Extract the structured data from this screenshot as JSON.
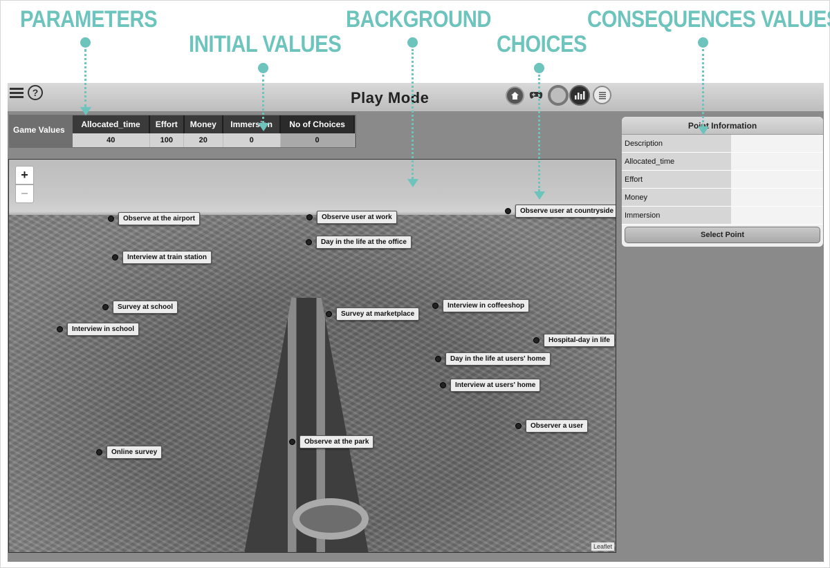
{
  "callouts": {
    "parameters": "PARAMETERS",
    "initial_values": "INITIAL VALUES",
    "background": "BACKGROUND",
    "choices": "CHOICES",
    "consequences_values": "CONSEQUENCES VALUES"
  },
  "colors": {
    "callout_accent": "#6cc4bd",
    "header_bg": "#c8c8c8",
    "app_bg": "#8a8a8a",
    "table_header_bg": "#3a3a3a"
  },
  "header": {
    "title": "Play Mode",
    "left_icons": [
      "language-icon",
      "help-icon"
    ],
    "right_icons": [
      "home-icon",
      "gamepad-icon",
      "cycle-icon",
      "stats-icon",
      "list-icon"
    ]
  },
  "game_values": {
    "label": "Game Values",
    "columns": [
      "Allocated_time",
      "Effort",
      "Money",
      "Immersion",
      "No of Choices"
    ],
    "values": [
      "40",
      "100",
      "20",
      "0",
      "0"
    ]
  },
  "map": {
    "zoom_in": "+",
    "zoom_out": "−",
    "attribution": "Leaflet",
    "markers": [
      "Observe at the airport",
      "Observe user at work",
      "Observe user at countryside",
      "Day in the life at the office",
      "Interview at train station",
      "Survey at school",
      "Interview in coffeeshop",
      "Survey at marketplace",
      "Interview in school",
      "Hospital-day in life",
      "Day in the life at users' home",
      "Interview at users' home",
      "Observer a user",
      "Observe at the park",
      "Online survey"
    ]
  },
  "point_information": {
    "title": "Point Information",
    "rows": [
      "Description",
      "Allocated_time",
      "Effort",
      "Money",
      "Immersion"
    ],
    "button": "Select Point"
  }
}
